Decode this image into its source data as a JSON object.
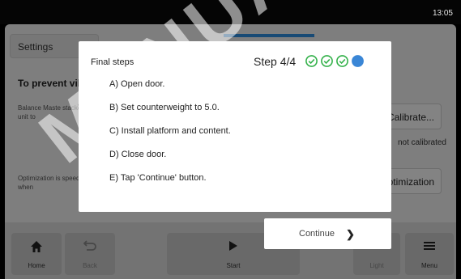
{
  "status_bar": {
    "time": "13:05"
  },
  "background": {
    "tab_label": "Settings",
    "heading": "To prevent vib",
    "description_1": "Balance Maste stacked unit to",
    "description_2": "Optimization is speed or when",
    "calibrate_label": "Calibrate...",
    "calibration_status": "not calibrated",
    "optimization_label": "Optimization",
    "accent_color": "#2f8fe0"
  },
  "bottom_nav": {
    "home": "Home",
    "back": "Back",
    "start": "Start",
    "light": "Light",
    "menu": "Menu"
  },
  "dialog": {
    "title": "Final steps",
    "step_label": "Step 4/4",
    "steps_total": 4,
    "steps_completed": 3,
    "current_step": 4,
    "done_color": "#33b14a",
    "current_color": "#3a86d6",
    "steps": [
      "A) Open door.",
      "B) Set counterweight to 5.0.",
      "C) Install platform and content.",
      "D) Close door.",
      "E) Tap 'Continue' button."
    ],
    "continue_label": "Continue"
  },
  "watermark": "MANUAL"
}
